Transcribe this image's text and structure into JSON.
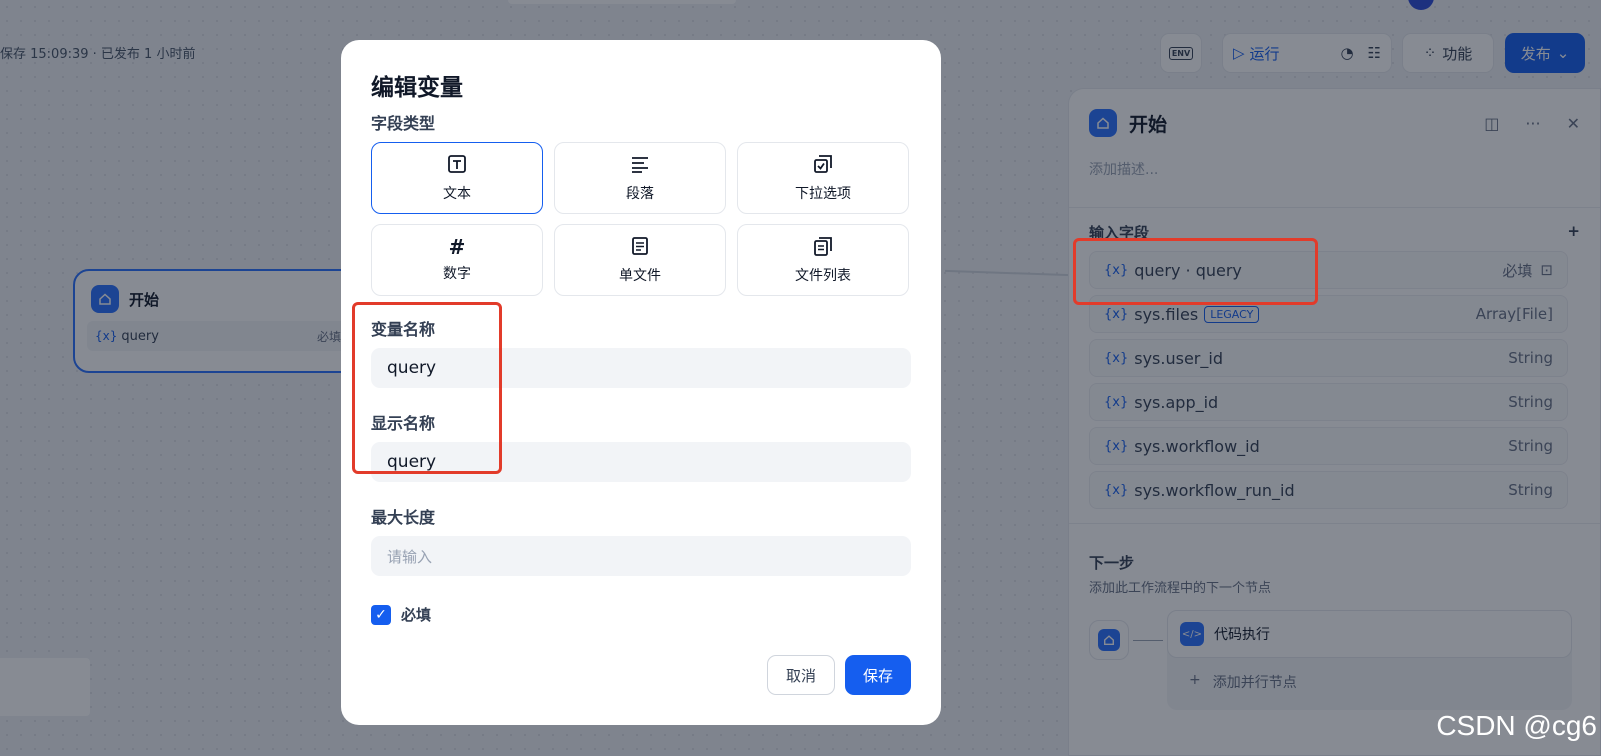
{
  "topbar": {
    "save_status": "保存 15:09:39 · 已发布 1 小时前",
    "env_label": "ENV",
    "run_label": "运行",
    "features_label": "功能",
    "publish_label": "发布"
  },
  "canvas_node": {
    "title": "开始",
    "variable": "query",
    "required": "必填"
  },
  "panel": {
    "title": "开始",
    "description_placeholder": "添加描述...",
    "input_fields_title": "输入字段",
    "fields": [
      {
        "name": "query · query",
        "type": "必填"
      },
      {
        "name": "sys.files",
        "badge": "LEGACY",
        "type": "Array[File]"
      },
      {
        "name": "sys.user_id",
        "type": "String"
      },
      {
        "name": "sys.app_id",
        "type": "String"
      },
      {
        "name": "sys.workflow_id",
        "type": "String"
      },
      {
        "name": "sys.workflow_run_id",
        "type": "String"
      }
    ],
    "next_title": "下一步",
    "next_desc": "添加此工作流程中的下一个节点",
    "next_node": "代码执行",
    "add_parallel": "添加并行节点"
  },
  "modal": {
    "title": "编辑变量",
    "field_type_label": "字段类型",
    "types": [
      {
        "label": "文本",
        "icon": "text-icon",
        "selected": true
      },
      {
        "label": "段落",
        "icon": "paragraph-icon"
      },
      {
        "label": "下拉选项",
        "icon": "select-icon"
      },
      {
        "label": "数字",
        "icon": "number-icon"
      },
      {
        "label": "单文件",
        "icon": "file-icon"
      },
      {
        "label": "文件列表",
        "icon": "file-list-icon"
      }
    ],
    "var_name_label": "变量名称",
    "var_name_value": "query",
    "display_name_label": "显示名称",
    "display_name_value": "query",
    "max_length_label": "最大长度",
    "max_length_placeholder": "请输入",
    "required_label": "必填",
    "required_checked": true,
    "cancel_label": "取消",
    "save_label": "保存"
  },
  "watermark": "CSDN @cg6",
  "colors": {
    "accent": "#155eef",
    "highlight": "#e23b2a"
  }
}
